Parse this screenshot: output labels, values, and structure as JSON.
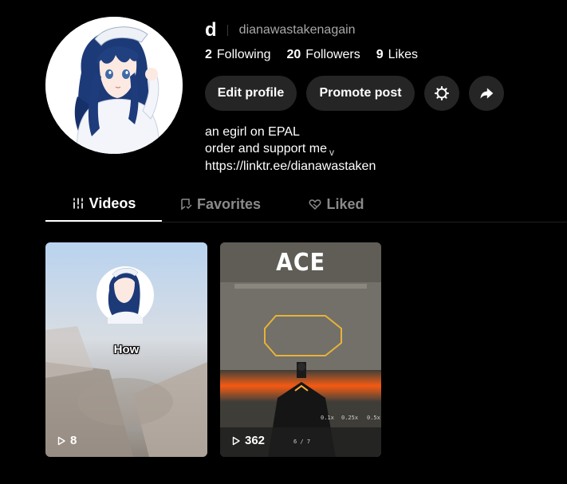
{
  "profile": {
    "display_name": "d",
    "handle": "dianawastakenagain",
    "stats": [
      {
        "value": "2",
        "label": "Following"
      },
      {
        "value": "20",
        "label": "Followers"
      },
      {
        "value": "9",
        "label": "Likes"
      }
    ],
    "buttons": {
      "edit": "Edit profile",
      "promote": "Promote post"
    },
    "bio": [
      "an egirl on EPAL",
      "order and support me",
      "https://linktr.ee/dianawastaken"
    ],
    "bio_chevron": "v"
  },
  "tabs": [
    {
      "label": "Videos",
      "icon": "grid-lines-icon",
      "active": true
    },
    {
      "label": "Favorites",
      "icon": "bookmark-icon",
      "active": false
    },
    {
      "label": "Liked",
      "icon": "heart-icon",
      "active": false
    }
  ],
  "videos": [
    {
      "views": "8",
      "caption": "How"
    },
    {
      "views": "362",
      "overlay_title": "ACE"
    }
  ],
  "colors": {
    "background": "#000000",
    "button_bg": "#252525",
    "muted_text": "#a8a8a8",
    "inactive_tab": "#8a8a8a"
  }
}
